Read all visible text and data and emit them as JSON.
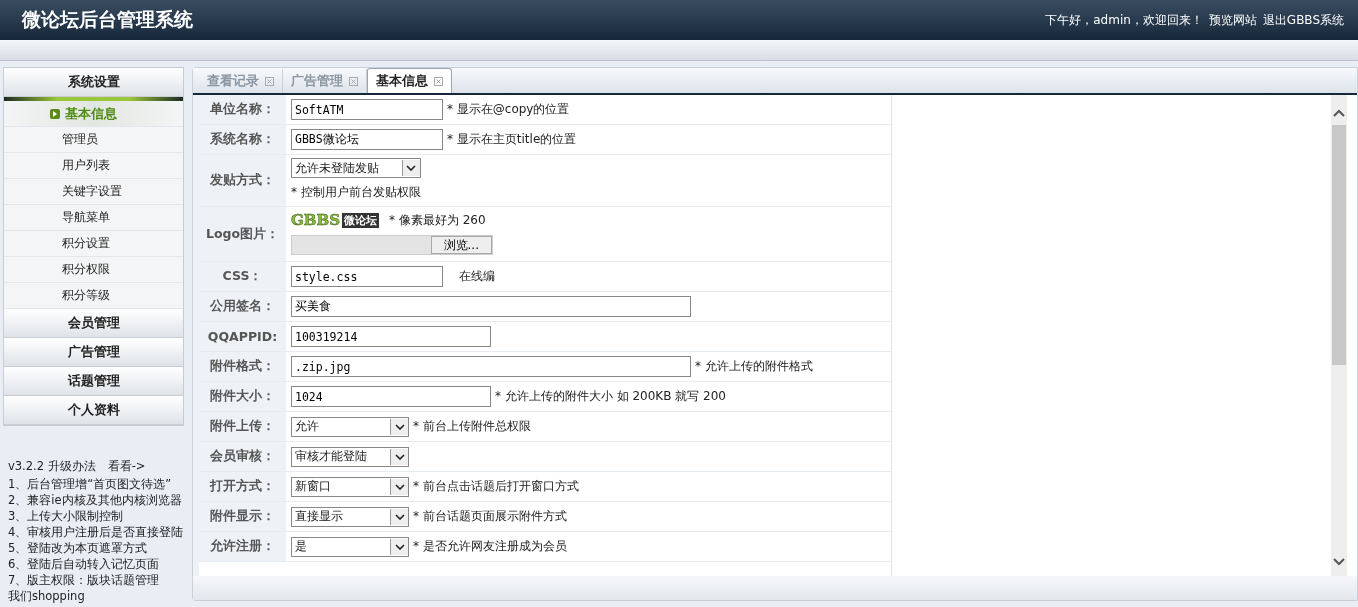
{
  "header": {
    "title": "微论坛后台管理系统",
    "greeting": "下午好，admin，欢迎回来！",
    "links": [
      "预览网站",
      "退出GBBS系统"
    ]
  },
  "sidebar": {
    "groups": [
      {
        "label": "系统设置",
        "expanded": true,
        "items": [
          {
            "label": "基本信息",
            "selected": true
          },
          {
            "label": "管理员",
            "selected": false
          },
          {
            "label": "用户列表",
            "selected": false
          },
          {
            "label": "关键字设置",
            "selected": false
          },
          {
            "label": "导航菜单",
            "selected": false
          },
          {
            "label": "积分设置",
            "selected": false
          },
          {
            "label": "积分权限",
            "selected": false
          },
          {
            "label": "积分等级",
            "selected": false
          }
        ]
      },
      {
        "label": "会员管理",
        "expanded": false
      },
      {
        "label": "广告管理",
        "expanded": false
      },
      {
        "label": "话题管理",
        "expanded": false
      },
      {
        "label": "个人资料",
        "expanded": false
      }
    ],
    "notes": [
      "v3.2.2 升级办法　看看->",
      "1、后台管理增“首页图文待选”",
      "2、兼容ie内核及其他内核浏览器",
      "3、上传大小限制控制",
      "4、审核用户注册后是否直接登陆",
      "5、登陆改为本页遮罩方式",
      "6、登陆后自动转入记忆页面",
      "7、版主权限：版块话题管理",
      "我们shopping"
    ]
  },
  "tabs": [
    {
      "label": "查看记录",
      "selected": false
    },
    {
      "label": "广告管理",
      "selected": false
    },
    {
      "label": "基本信息",
      "selected": true
    }
  ],
  "form": [
    {
      "label": "单位名称：",
      "kind": "input",
      "value": "SoftATM",
      "hint": "* 显示在@copy的位置"
    },
    {
      "label": "系统名称：",
      "kind": "input",
      "value": "GBBS微论坛",
      "hint": "* 显示在主页title的位置"
    },
    {
      "label": "发贴方式：",
      "kind": "select-below",
      "value": "允许未登陆发贴",
      "hint": "* 控制用户前台发贴权限"
    },
    {
      "label": "Logo图片：",
      "kind": "logo",
      "logo": [
        "GBBS",
        "微论坛"
      ],
      "hint": "* 像素最好为 260",
      "button": "浏览..."
    },
    {
      "label": "CSS：",
      "kind": "input",
      "value": "style.css",
      "link": "在线编"
    },
    {
      "label": "公用签名：",
      "kind": "long-input",
      "value": "买美食"
    },
    {
      "label": "QQAPPID:",
      "kind": "mid-input",
      "value": "100319214"
    },
    {
      "label": "附件格式：",
      "kind": "long-input",
      "value": ".zip.jpg",
      "hint": "* 允许上传的附件格式"
    },
    {
      "label": "附件大小：",
      "kind": "mid-input",
      "value": "1024",
      "hint": "* 允许上传的附件大小  如  200KB 就写  200"
    },
    {
      "label": "附件上传：",
      "kind": "select",
      "value": "允许",
      "hint": "* 前台上传附件总权限"
    },
    {
      "label": "会员审核：",
      "kind": "select",
      "value": "审核才能登陆"
    },
    {
      "label": "打开方式：",
      "kind": "select",
      "value": "新窗口",
      "hint": "* 前台点击话题后打开窗口方式"
    },
    {
      "label": "附件显示：",
      "kind": "select",
      "value": "直接显示",
      "hint": "* 前台话题页面展示附件方式"
    },
    {
      "label": "允许注册：",
      "kind": "select",
      "value": "是",
      "hint": "* 是否允许网友注册成为会员"
    }
  ]
}
